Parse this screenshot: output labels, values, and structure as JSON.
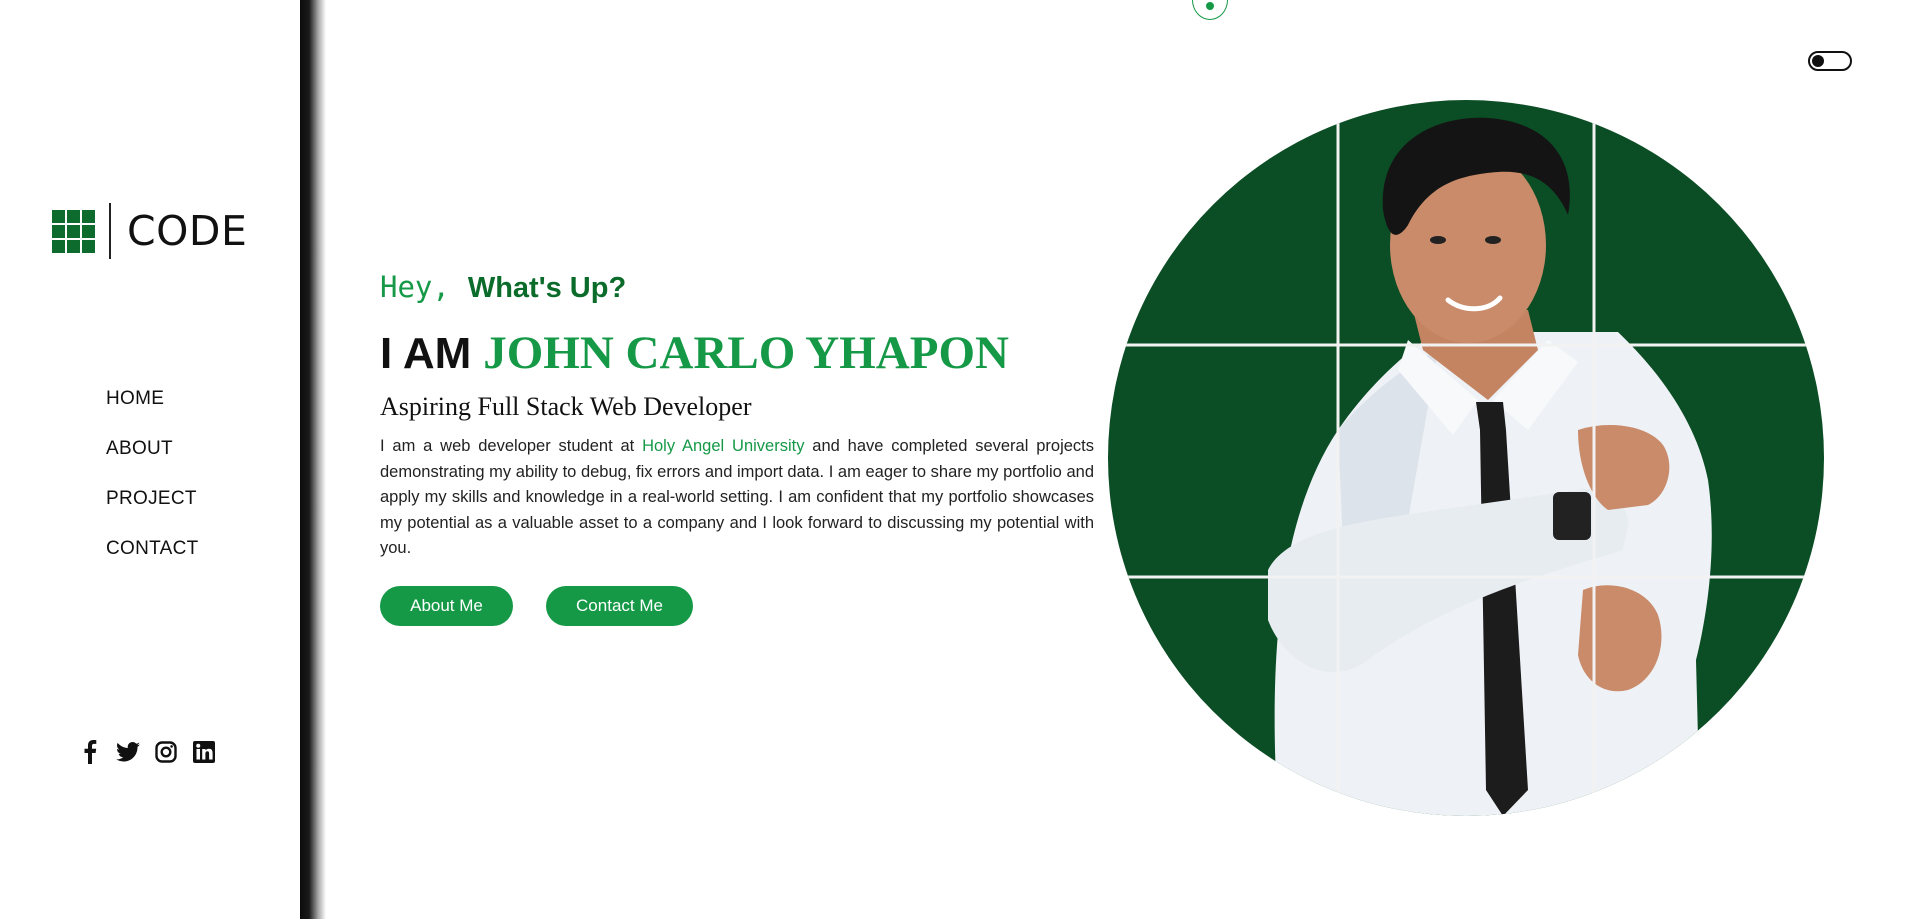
{
  "brand": {
    "logo_text": "CODE"
  },
  "nav": {
    "items": [
      "HOME",
      "ABOUT",
      "PROJECT",
      "CONTACT"
    ]
  },
  "socials": [
    "facebook-icon",
    "twitter-icon",
    "instagram-icon",
    "linkedin-icon"
  ],
  "hero": {
    "greeting_hey": "Hey,",
    "greeting_whats_up": "What's Up?",
    "iam_prefix": "I AM",
    "name": "JOHN CARLO YHAPON",
    "role": "Aspiring Full Stack Web Developer",
    "bio_before": "I am a web developer student at ",
    "bio_university": "Holy Angel University",
    "bio_after": " and have completed several projects demonstrating my ability to debug, fix errors and import data. I am eager to share my portfolio and apply my skills and knowledge in a real-world setting. I am confident that my portfolio showcases my potential as a valuable asset to a company and I look forward to discussing my potential with you.",
    "about_button": "About Me",
    "contact_button": "Contact Me"
  },
  "colors": {
    "accent": "#159947",
    "accent_dark": "#0b6b2a",
    "portrait_background": "#0b4d24"
  }
}
